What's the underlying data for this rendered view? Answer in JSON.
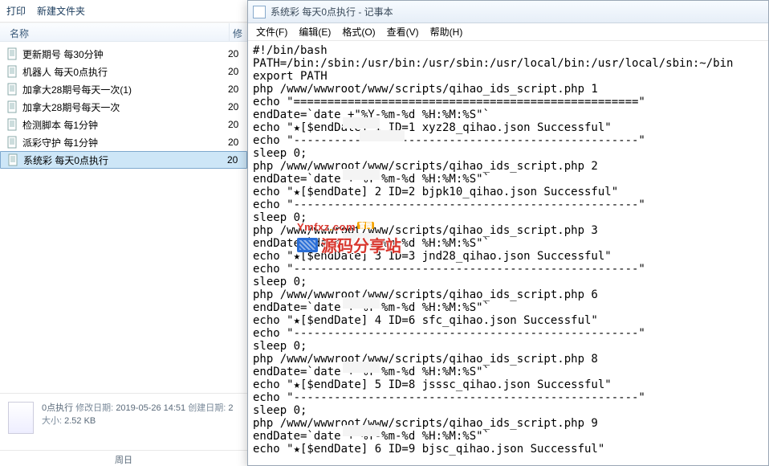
{
  "toolbar": {
    "print": "打印",
    "newfolder": "新建文件夹"
  },
  "explorer": {
    "col_name": "名称",
    "col_mod": "修",
    "files": [
      {
        "name": "更新期号 每30分钟",
        "mod": "20"
      },
      {
        "name": "机器人 每天0点执行",
        "mod": "20"
      },
      {
        "name": "加拿大28期号每天一次(1)",
        "mod": "20"
      },
      {
        "name": "加拿大28期号每天一次",
        "mod": "20"
      },
      {
        "name": "检测脚本 每1分钟",
        "mod": "20"
      },
      {
        "name": "派彩守护 每1分钟",
        "mod": "20"
      },
      {
        "name": "系统彩 每天0点执行",
        "mod": "20"
      }
    ],
    "details": {
      "title": "0点执行",
      "mod_lbl": "修改日期:",
      "mod_val": "2019-05-26 14:51",
      "size_lbl": "大小:",
      "size_val": "2.52 KB",
      "create_lbl": "创建日期:",
      "create_val": "2"
    },
    "status": "周日"
  },
  "notepad": {
    "title": "系统彩 每天0点执行 - 记事本",
    "menu": {
      "file": "文件(F)",
      "edit": "编辑(E)",
      "format": "格式(O)",
      "view": "查看(V)",
      "help": "帮助(H)"
    },
    "content": "#!/bin/bash\nPATH=/bin:/sbin:/usr/bin:/usr/sbin:/usr/local/bin:/usr/local/sbin:~/bin\nexport PATH\nphp /www/wwwroot/www/scripts/qihao_ids_script.php 1\necho \"===================================================\"\nendDate=`date +\"%Y-%m-%d %H:%M:%S\"`\necho \"★[$endDate] 1 ID=1 xyz28_qihao.json Successful\"\necho \"---------------------------------------------------\"\nsleep 0;\nphp /www/wwwroot/www/scripts/qihao_ids_script.php 2\nendDate=`date +\"%Y-%m-%d %H:%M:%S\"`\necho \"★[$endDate] 2 ID=2 bjpk10_qihao.json Successful\"\necho \"---------------------------------------------------\"\nsleep 0;\nphp /www/wwwroot/www/scripts/qihao_ids_script.php 3\nendDate=`date +\"%Y-%m-%d %H:%M:%S\"`\necho \"★[$endDate] 3 ID=3 jnd28_qihao.json Successful\"\necho \"---------------------------------------------------\"\nsleep 0;\nphp /www/wwwroot/www/scripts/qihao_ids_script.php 6\nendDate=`date +\"%Y-%m-%d %H:%M:%S\"`\necho \"★[$endDate] 4 ID=6 sfc_qihao.json Successful\"\necho \"---------------------------------------------------\"\nsleep 0;\nphp /www/wwwroot/www/scripts/qihao_ids_script.php 8\nendDate=`date +\"%Y-%m-%d %H:%M:%S\"`\necho \"★[$endDate] 5 ID=8 jsssc_qihao.json Successful\"\necho \"---------------------------------------------------\"\nsleep 0;\nphp /www/wwwroot/www/scripts/qihao_ids_script.php 9\nendDate=`date +\"%Y-%m-%d %H:%M:%S\"`\necho \"★[$endDate] 6 ID=9 bjsc_qihao.json Successful\""
  },
  "watermark": {
    "top": "Ymfxz",
    "dot": ".",
    "com": "com",
    "badge": "官网",
    "main": "源码分享站"
  }
}
